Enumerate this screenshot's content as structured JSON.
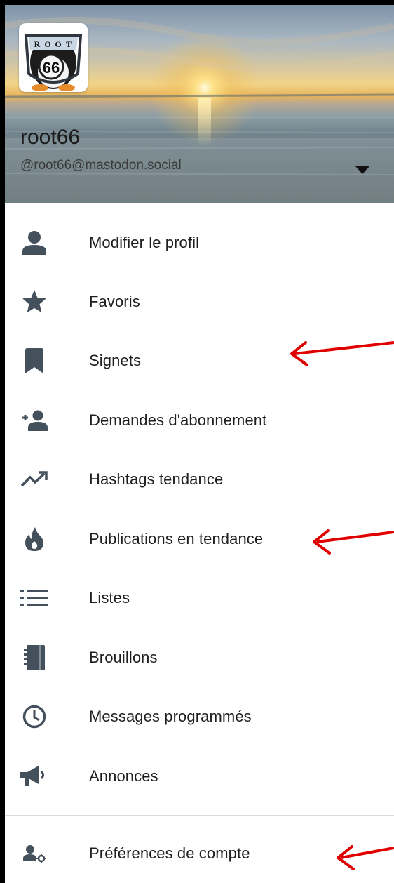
{
  "header": {
    "display_name": "root66",
    "handle": "@root66@mastodon.social",
    "avatar_lettering": [
      "R",
      "O",
      "O",
      "T",
      "66"
    ]
  },
  "menu": {
    "items": [
      {
        "id": "edit-profile",
        "label": "Modifier le profil",
        "icon": "person-icon"
      },
      {
        "id": "favourites",
        "label": "Favoris",
        "icon": "star-icon"
      },
      {
        "id": "bookmarks",
        "label": "Signets",
        "icon": "bookmark-icon"
      },
      {
        "id": "follow-requests",
        "label": "Demandes d'abonnement",
        "icon": "person-add-icon"
      },
      {
        "id": "trending-hashtags",
        "label": "Hashtags tendance",
        "icon": "trending-icon"
      },
      {
        "id": "trending-posts",
        "label": "Publications en tendance",
        "icon": "flame-icon"
      },
      {
        "id": "lists",
        "label": "Listes",
        "icon": "list-icon"
      },
      {
        "id": "drafts",
        "label": "Brouillons",
        "icon": "notebook-icon"
      },
      {
        "id": "scheduled",
        "label": "Messages programmés",
        "icon": "clock-icon"
      },
      {
        "id": "announcements",
        "label": "Annonces",
        "icon": "megaphone-icon"
      }
    ],
    "footer": {
      "id": "account-preferences",
      "label": "Préférences de compte",
      "icon": "account-settings-icon"
    }
  },
  "colors": {
    "icon": "#44505c",
    "text": "#1f1f1f",
    "annotation_arrow": "#e00000",
    "divider": "#d6dde3"
  }
}
